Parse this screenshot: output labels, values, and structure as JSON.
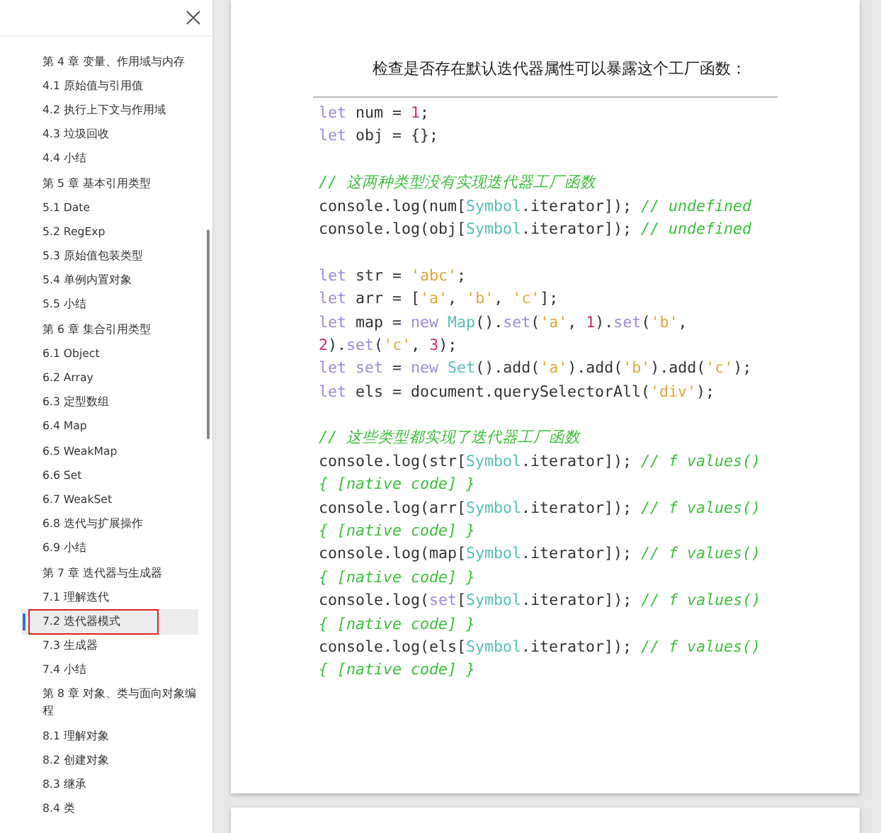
{
  "sidebar": {
    "items": [
      {
        "label": "第 4 章 变量、作用域与内存",
        "selected": false,
        "highlighted": false
      },
      {
        "label": "4.1 原始值与引用值",
        "selected": false,
        "highlighted": false
      },
      {
        "label": "4.2 执行上下文与作用域",
        "selected": false,
        "highlighted": false
      },
      {
        "label": "4.3 垃圾回收",
        "selected": false,
        "highlighted": false
      },
      {
        "label": "4.4 小结",
        "selected": false,
        "highlighted": false
      },
      {
        "label": "第 5 章 基本引用类型",
        "selected": false,
        "highlighted": false
      },
      {
        "label": "5.1 Date",
        "selected": false,
        "highlighted": false
      },
      {
        "label": "5.2 RegExp",
        "selected": false,
        "highlighted": false
      },
      {
        "label": "5.3 原始值包装类型",
        "selected": false,
        "highlighted": false
      },
      {
        "label": "5.4 单例内置对象",
        "selected": false,
        "highlighted": false
      },
      {
        "label": "5.5 小结",
        "selected": false,
        "highlighted": false
      },
      {
        "label": "第 6 章 集合引用类型",
        "selected": false,
        "highlighted": false
      },
      {
        "label": "6.1 Object",
        "selected": false,
        "highlighted": false
      },
      {
        "label": "6.2 Array",
        "selected": false,
        "highlighted": false
      },
      {
        "label": "6.3 定型数组",
        "selected": false,
        "highlighted": false
      },
      {
        "label": "6.4 Map",
        "selected": false,
        "highlighted": false
      },
      {
        "label": "6.5 WeakMap",
        "selected": false,
        "highlighted": false
      },
      {
        "label": "6.6 Set",
        "selected": false,
        "highlighted": false
      },
      {
        "label": "6.7 WeakSet",
        "selected": false,
        "highlighted": false
      },
      {
        "label": "6.8 迭代与扩展操作",
        "selected": false,
        "highlighted": false
      },
      {
        "label": "6.9 小结",
        "selected": false,
        "highlighted": false
      },
      {
        "label": "第 7 章 迭代器与生成器",
        "selected": false,
        "highlighted": false
      },
      {
        "label": "7.1 理解迭代",
        "selected": false,
        "highlighted": false
      },
      {
        "label": "7.2 迭代器模式",
        "selected": true,
        "highlighted": true
      },
      {
        "label": "7.3 生成器",
        "selected": false,
        "highlighted": false
      },
      {
        "label": "7.4 小结",
        "selected": false,
        "highlighted": false
      },
      {
        "label": "第 8 章 对象、类与面向对象编程",
        "selected": false,
        "highlighted": false
      },
      {
        "label": "8.1 理解对象",
        "selected": false,
        "highlighted": false
      },
      {
        "label": "8.2 创建对象",
        "selected": false,
        "highlighted": false
      },
      {
        "label": "8.3 继承",
        "selected": false,
        "highlighted": false
      },
      {
        "label": "8.4 类",
        "selected": false,
        "highlighted": false
      }
    ]
  },
  "document": {
    "heading": "检查是否存在默认迭代器属性可以暴露这个工厂函数：",
    "code_blocks": [
      [
        [
          {
            "text": "let",
            "kind": "kw"
          },
          {
            "text": " num = ",
            "kind": "plain"
          },
          {
            "text": "1",
            "kind": "num"
          },
          {
            "text": ";",
            "kind": "plain"
          }
        ],
        [
          {
            "text": "let",
            "kind": "kw"
          },
          {
            "text": " obj = {};",
            "kind": "plain"
          }
        ]
      ],
      [
        [
          {
            "text": "// 这两种类型没有实现迭代器工厂函数",
            "kind": "comment"
          }
        ],
        [
          {
            "text": "console.log(num[",
            "kind": "plain"
          },
          {
            "text": "Symbol",
            "kind": "type"
          },
          {
            "text": ".iterator]); ",
            "kind": "plain"
          },
          {
            "text": "// undefined",
            "kind": "comment"
          }
        ],
        [
          {
            "text": "console.log(obj[",
            "kind": "plain"
          },
          {
            "text": "Symbol",
            "kind": "type"
          },
          {
            "text": ".iterator]); ",
            "kind": "plain"
          },
          {
            "text": "// undefined",
            "kind": "comment"
          }
        ]
      ],
      [
        [
          {
            "text": "let",
            "kind": "kw"
          },
          {
            "text": " str = ",
            "kind": "plain"
          },
          {
            "text": "'abc'",
            "kind": "str"
          },
          {
            "text": ";",
            "kind": "plain"
          }
        ],
        [
          {
            "text": "let",
            "kind": "kw"
          },
          {
            "text": " arr = [",
            "kind": "plain"
          },
          {
            "text": "'a'",
            "kind": "str"
          },
          {
            "text": ", ",
            "kind": "plain"
          },
          {
            "text": "'b'",
            "kind": "str"
          },
          {
            "text": ", ",
            "kind": "plain"
          },
          {
            "text": "'c'",
            "kind": "str"
          },
          {
            "text": "];",
            "kind": "plain"
          }
        ],
        [
          {
            "text": "let",
            "kind": "kw"
          },
          {
            "text": " map = ",
            "kind": "plain"
          },
          {
            "text": "new ",
            "kind": "kw"
          },
          {
            "text": "Map",
            "kind": "type"
          },
          {
            "text": "().",
            "kind": "plain"
          },
          {
            "text": "set",
            "kind": "kw"
          },
          {
            "text": "(",
            "kind": "plain"
          },
          {
            "text": "'a'",
            "kind": "str"
          },
          {
            "text": ", ",
            "kind": "plain"
          },
          {
            "text": "1",
            "kind": "num"
          },
          {
            "text": ").",
            "kind": "plain"
          },
          {
            "text": "set",
            "kind": "kw"
          },
          {
            "text": "(",
            "kind": "plain"
          },
          {
            "text": "'b'",
            "kind": "str"
          },
          {
            "text": ",",
            "kind": "plain"
          }
        ],
        [
          {
            "text": "2",
            "kind": "num"
          },
          {
            "text": ").",
            "kind": "plain"
          },
          {
            "text": "set",
            "kind": "kw"
          },
          {
            "text": "(",
            "kind": "plain"
          },
          {
            "text": "'c'",
            "kind": "str"
          },
          {
            "text": ", ",
            "kind": "plain"
          },
          {
            "text": "3",
            "kind": "num"
          },
          {
            "text": ");",
            "kind": "plain"
          }
        ],
        [
          {
            "text": "let set",
            "kind": "kw"
          },
          {
            "text": " = ",
            "kind": "plain"
          },
          {
            "text": "new ",
            "kind": "kw"
          },
          {
            "text": "Set",
            "kind": "type"
          },
          {
            "text": "().add(",
            "kind": "plain"
          },
          {
            "text": "'a'",
            "kind": "str"
          },
          {
            "text": ").add(",
            "kind": "plain"
          },
          {
            "text": "'b'",
            "kind": "str"
          },
          {
            "text": ").add(",
            "kind": "plain"
          },
          {
            "text": "'c'",
            "kind": "str"
          },
          {
            "text": ");",
            "kind": "plain"
          }
        ],
        [
          {
            "text": "let",
            "kind": "kw"
          },
          {
            "text": " els = document.querySelectorAll(",
            "kind": "plain"
          },
          {
            "text": "'div'",
            "kind": "str"
          },
          {
            "text": ");",
            "kind": "plain"
          }
        ]
      ],
      [
        [
          {
            "text": "// 这些类型都实现了迭代器工厂函数",
            "kind": "comment"
          }
        ],
        [
          {
            "text": "console.log(str[",
            "kind": "plain"
          },
          {
            "text": "Symbol",
            "kind": "type"
          },
          {
            "text": ".iterator]); ",
            "kind": "plain"
          },
          {
            "text": "// f values()",
            "kind": "comment"
          }
        ],
        [
          {
            "text": "{ [native code] }",
            "kind": "comment"
          }
        ],
        [
          {
            "text": "console.log(arr[",
            "kind": "plain"
          },
          {
            "text": "Symbol",
            "kind": "type"
          },
          {
            "text": ".iterator]); ",
            "kind": "plain"
          },
          {
            "text": "// f values()",
            "kind": "comment"
          }
        ],
        [
          {
            "text": "{ [native code] }",
            "kind": "comment"
          }
        ],
        [
          {
            "text": "console.log(map[",
            "kind": "plain"
          },
          {
            "text": "Symbol",
            "kind": "type"
          },
          {
            "text": ".iterator]); ",
            "kind": "plain"
          },
          {
            "text": "// f values()",
            "kind": "comment"
          }
        ],
        [
          {
            "text": "{ [native code] }",
            "kind": "comment"
          }
        ],
        [
          {
            "text": "console.log(",
            "kind": "plain"
          },
          {
            "text": "set",
            "kind": "kw"
          },
          {
            "text": "[",
            "kind": "plain"
          },
          {
            "text": "Symbol",
            "kind": "type"
          },
          {
            "text": ".iterator]); ",
            "kind": "plain"
          },
          {
            "text": "// f values()",
            "kind": "comment"
          }
        ],
        [
          {
            "text": "{ [native code] }",
            "kind": "comment"
          }
        ],
        [
          {
            "text": "console.log(els[",
            "kind": "plain"
          },
          {
            "text": "Symbol",
            "kind": "type"
          },
          {
            "text": ".iterator]); ",
            "kind": "plain"
          },
          {
            "text": "// f values()",
            "kind": "comment"
          }
        ],
        [
          {
            "text": "{ [native code] }",
            "kind": "comment"
          }
        ]
      ]
    ]
  }
}
